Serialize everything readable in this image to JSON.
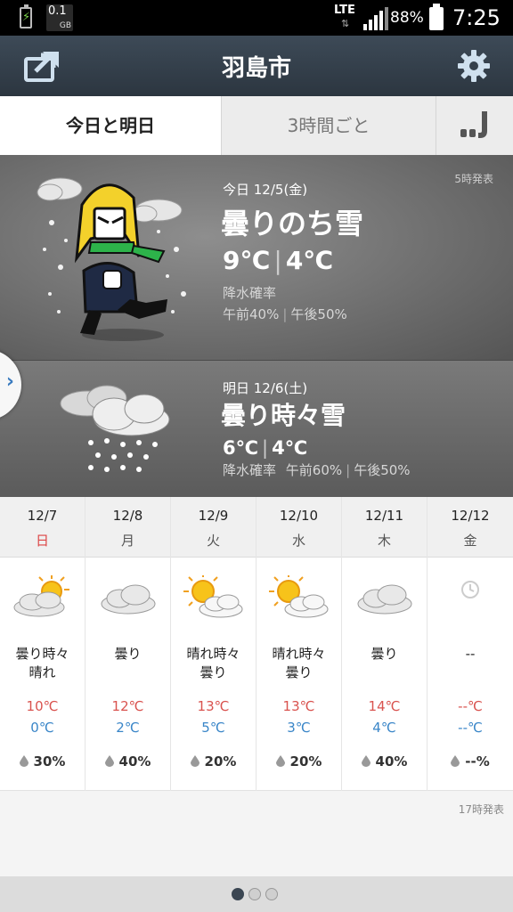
{
  "status_bar": {
    "data_value": "0.1",
    "data_unit": "GB",
    "network": "LTE",
    "battery_pct": "88%",
    "time": "7:25"
  },
  "header": {
    "title": "羽島市",
    "share_icon": "share-icon",
    "settings_icon": "gear-icon"
  },
  "tabs": {
    "today_tomorrow": "今日と明日",
    "every3h": "3時間ごと",
    "logo_icon": "app-logo-icon"
  },
  "today": {
    "issued": "5時発表",
    "date": "今日 12/5(金)",
    "condition": "曇りのち雪",
    "high": "9℃",
    "low": "4℃",
    "pop_label": "降水確率",
    "pop_am": "午前40%",
    "pop_pm": "午後50%"
  },
  "tomorrow": {
    "date": "明日 12/6(土)",
    "condition": "曇り時々雪",
    "high": "6℃",
    "low": "4℃",
    "pop_label": "降水確率",
    "pop_am": "午前60%",
    "pop_pm": "午後50%"
  },
  "week": [
    {
      "date": "12/7",
      "weekday": "日",
      "icon": "cloudy-sun-icon",
      "condition": "曇り時々\n晴れ",
      "high": "10℃",
      "low": "0℃",
      "pop": "30%"
    },
    {
      "date": "12/8",
      "weekday": "月",
      "icon": "cloudy-icon",
      "condition": "曇り",
      "high": "12℃",
      "low": "2℃",
      "pop": "40%"
    },
    {
      "date": "12/9",
      "weekday": "火",
      "icon": "sun-cloud-icon",
      "condition": "晴れ時々\n曇り",
      "high": "13℃",
      "low": "5℃",
      "pop": "20%"
    },
    {
      "date": "12/10",
      "weekday": "水",
      "icon": "sun-cloud-icon",
      "condition": "晴れ時々\n曇り",
      "high": "13℃",
      "low": "3℃",
      "pop": "20%"
    },
    {
      "date": "12/11",
      "weekday": "木",
      "icon": "cloudy-icon",
      "condition": "曇り",
      "high": "14℃",
      "low": "4℃",
      "pop": "40%"
    },
    {
      "date": "12/12",
      "weekday": "金",
      "icon": "clock-icon",
      "condition": "--",
      "high": "--℃",
      "low": "--℃",
      "pop": "--%"
    }
  ],
  "week_issued": "17時発表",
  "colors": {
    "header": "#2f3a45",
    "high_temp": "#d9534f",
    "low_temp": "#3a86c8",
    "sunday": "#dd4444"
  }
}
